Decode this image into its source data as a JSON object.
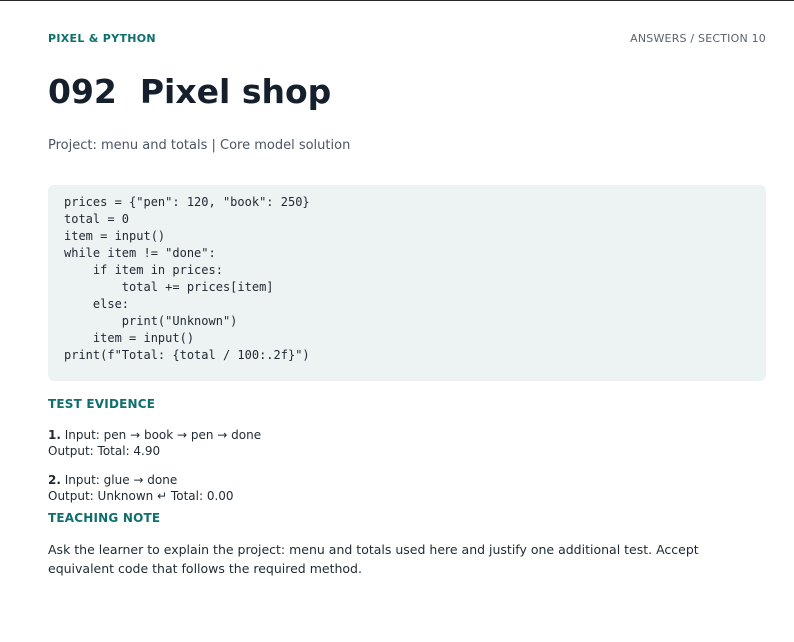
{
  "header": {
    "brand": "PIXEL & PYTHON",
    "section": "ANSWERS / SECTION 10"
  },
  "title": "092  Pixel shop",
  "subtitle": "Project: menu and totals | Core model solution",
  "code_lines": [
    "prices = {\"pen\": 120, \"book\": 250}",
    "total = 0",
    "item = input()",
    "while item != \"done\":",
    "    if item in prices:",
    "        total += prices[item]",
    "    else:",
    "        print(\"Unknown\")",
    "    item = input()",
    "print(f\"Total: {total / 100:.2f}\")"
  ],
  "test_evidence": {
    "heading": "TEST EVIDENCE",
    "items": [
      {
        "number": "1.",
        "input": " Input: pen → book → pen → done",
        "output": "Output: Total: 4.90"
      },
      {
        "number": "2.",
        "input": " Input: glue → done",
        "output": "Output: Unknown ↵ Total: 0.00"
      }
    ]
  },
  "teaching_note": {
    "heading": "TEACHING NOTE",
    "text": "Ask the learner to explain the project: menu and totals used here and justify one additional test. Accept equivalent code that follows the required method."
  }
}
